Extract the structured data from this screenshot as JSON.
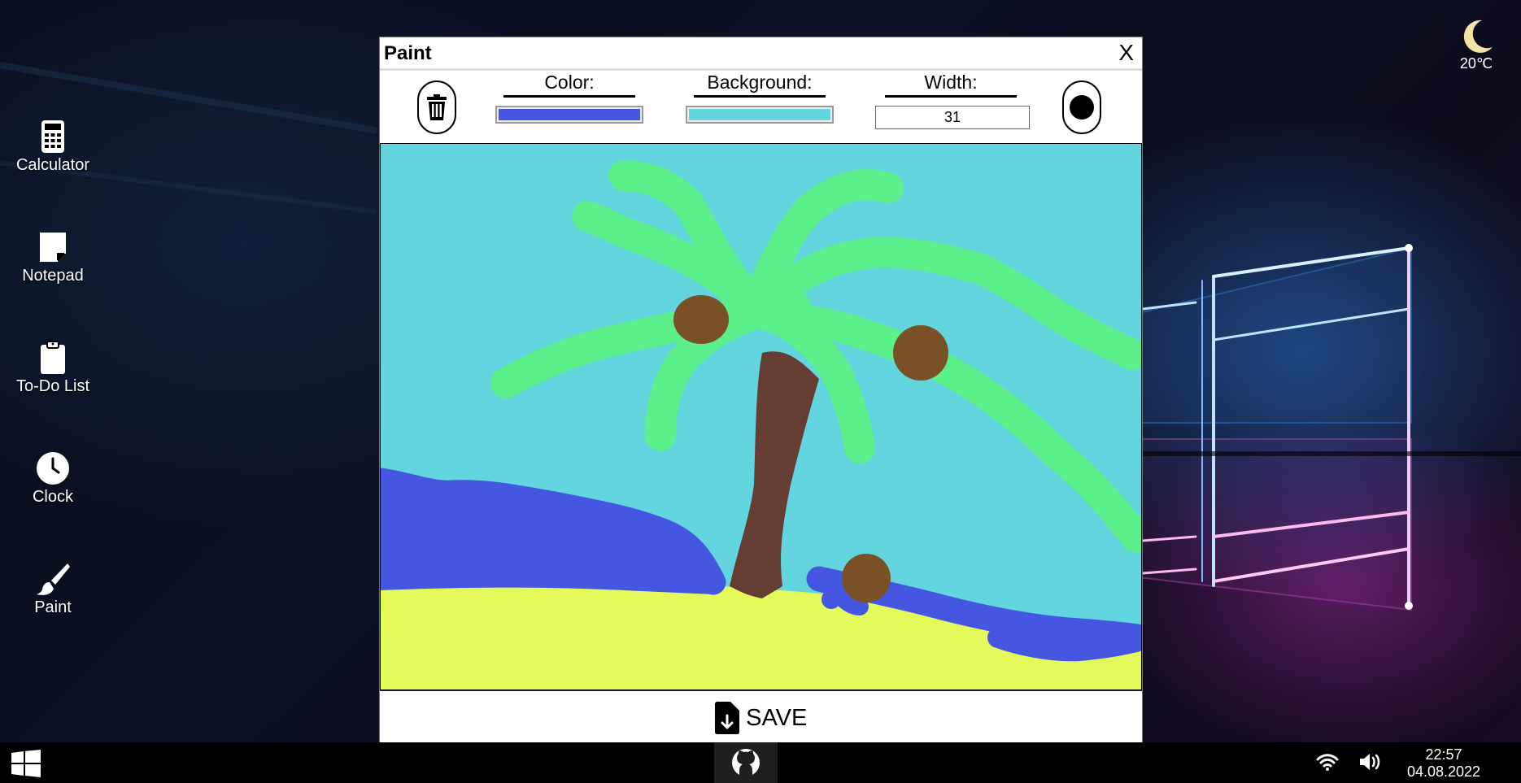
{
  "desktop": {
    "icons": [
      {
        "label": "Calculator",
        "icon": "calculator-icon"
      },
      {
        "label": "Notepad",
        "icon": "notepad-icon"
      },
      {
        "label": "To-Do List",
        "icon": "clipboard-icon"
      },
      {
        "label": "Clock",
        "icon": "clock-icon"
      },
      {
        "label": "Paint",
        "icon": "paintbrush-icon"
      }
    ],
    "weather": {
      "icon": "moon-icon",
      "temperature": "20℃"
    }
  },
  "paint": {
    "title": "Paint",
    "close_label": "X",
    "color_label": "Color:",
    "background_label": "Background:",
    "width_label": "Width:",
    "width_value": "31",
    "color_value": "#4557e0",
    "background_value": "#62d5df",
    "save_label": "SAVE",
    "icons": {
      "clear": "trash-icon",
      "brush": "brush-dot-icon",
      "save": "file-download-icon"
    }
  },
  "taskbar": {
    "start_icon": "windows-icon",
    "github_icon": "github-icon",
    "wifi_icon": "wifi-icon",
    "volume_icon": "volume-icon",
    "time": "22:57",
    "date": "04.08.2022"
  }
}
